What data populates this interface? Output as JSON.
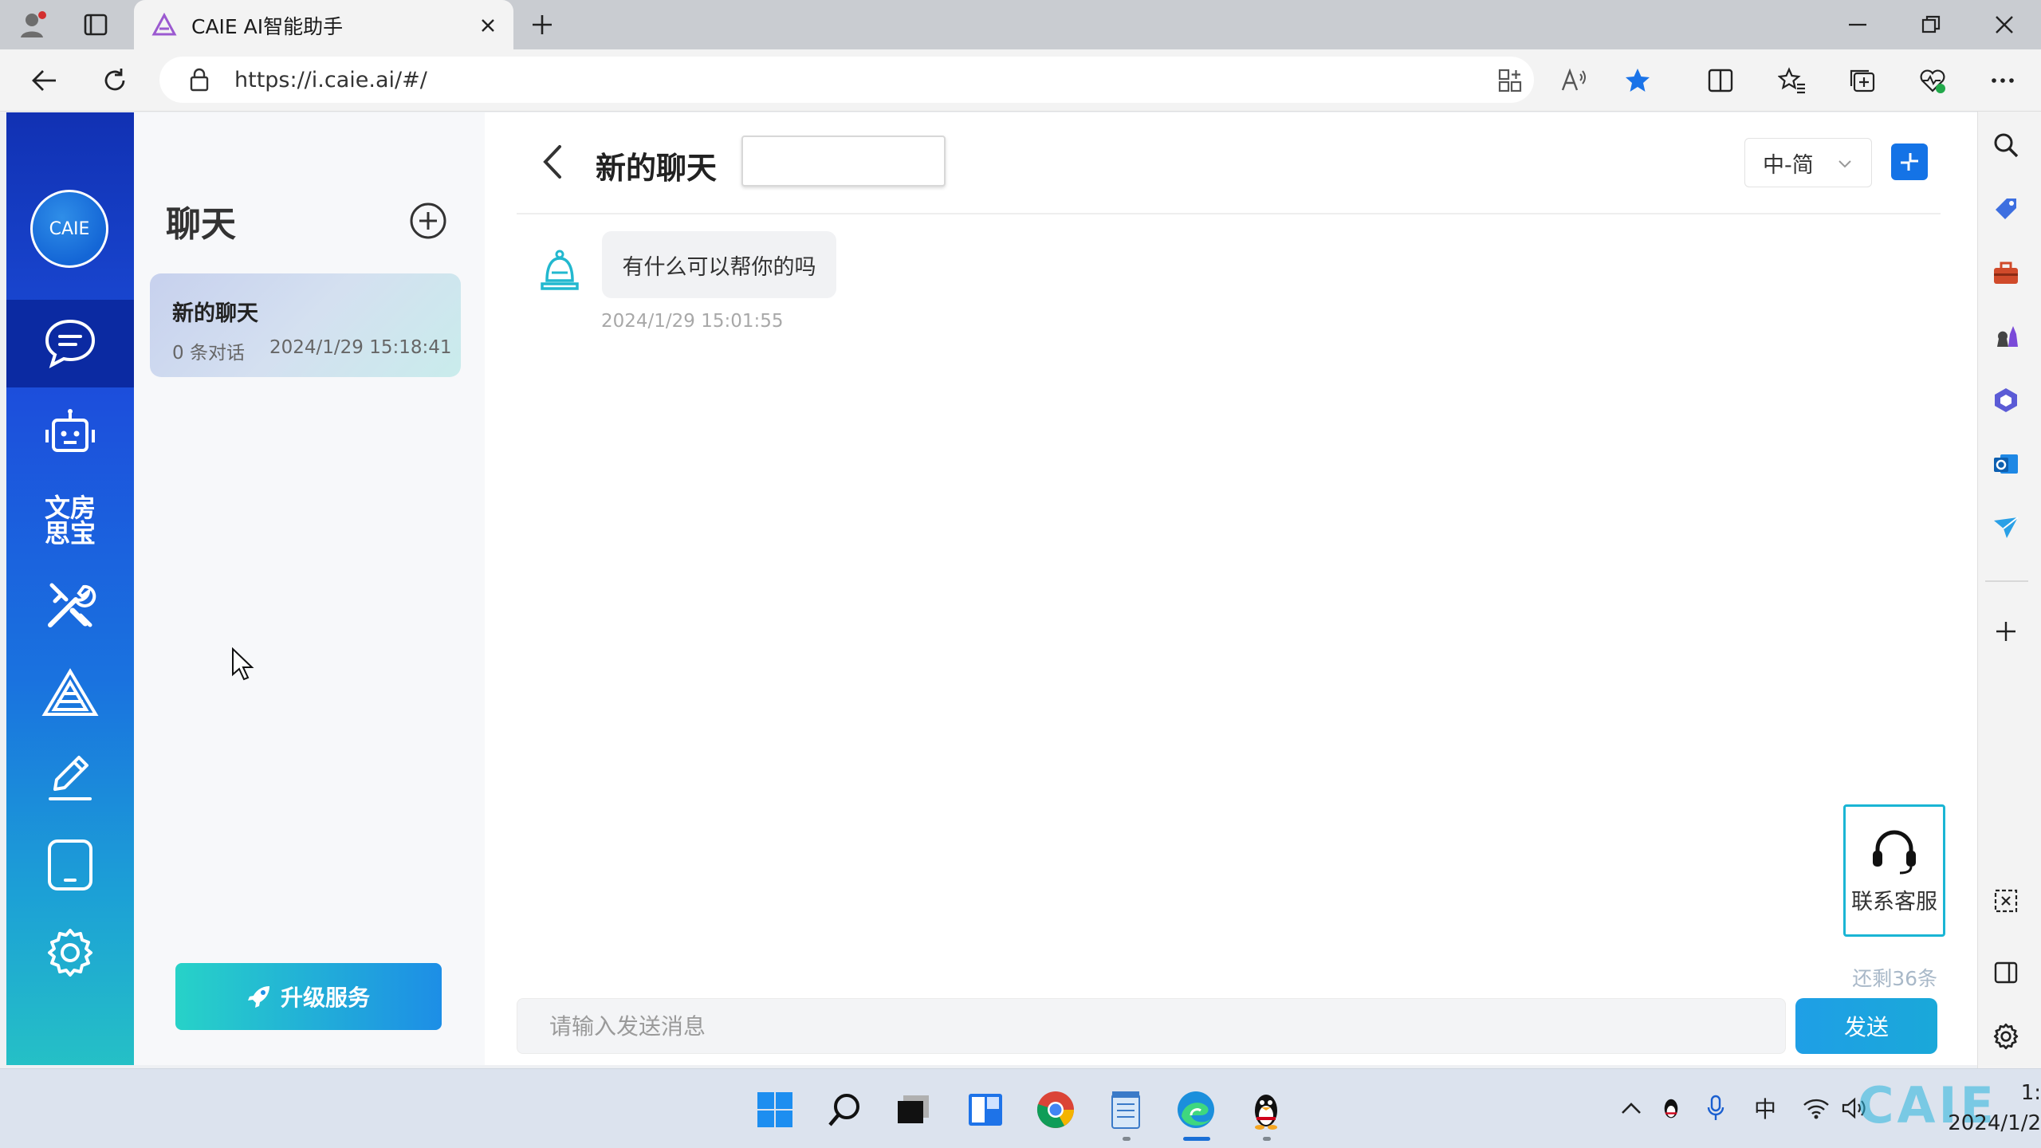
{
  "browser": {
    "tab_title": "CAIE AI智能助手",
    "url": "https://i.caie.ai/#/",
    "profile_icon": "profile-icon",
    "favorite_active_color": "#1a73e8"
  },
  "sidebar_nav": {
    "logo_text": "CAIE",
    "items": [
      {
        "icon": "chat-icon",
        "active": true
      },
      {
        "icon": "robot-icon"
      },
      {
        "icon": "wenfang-sibao-icon",
        "text": "文房\n思宝"
      },
      {
        "icon": "tools-icon"
      },
      {
        "icon": "triangle-logo-icon"
      },
      {
        "icon": "pencil-icon"
      },
      {
        "icon": "tablet-icon"
      },
      {
        "icon": "gear-icon"
      }
    ]
  },
  "chat_list": {
    "title": "聊天",
    "items": [
      {
        "title": "新的聊天",
        "count": "0 条对话",
        "time": "2024/1/29 15:18:41"
      }
    ],
    "upgrade_label": "升级服务"
  },
  "chat": {
    "title": "新的聊天",
    "title_input_value": "",
    "language": "中-简",
    "messages": [
      {
        "role": "bot",
        "text": "有什么可以帮你的吗",
        "time": "2024/1/29 15:01:55"
      }
    ],
    "service_label": "联系客服",
    "remaining": "还剩36条",
    "input_placeholder": "请输入发送消息",
    "send_label": "发送"
  },
  "taskbar": {
    "tray_ime": "中",
    "clock_time": "1:",
    "clock_date": "2024/1/2",
    "watermark": "CAIE"
  },
  "colors": {
    "nav_gradient_top": "#1131b3",
    "nav_gradient_bottom": "#25c0c6",
    "accent": "#1aa8d9"
  }
}
